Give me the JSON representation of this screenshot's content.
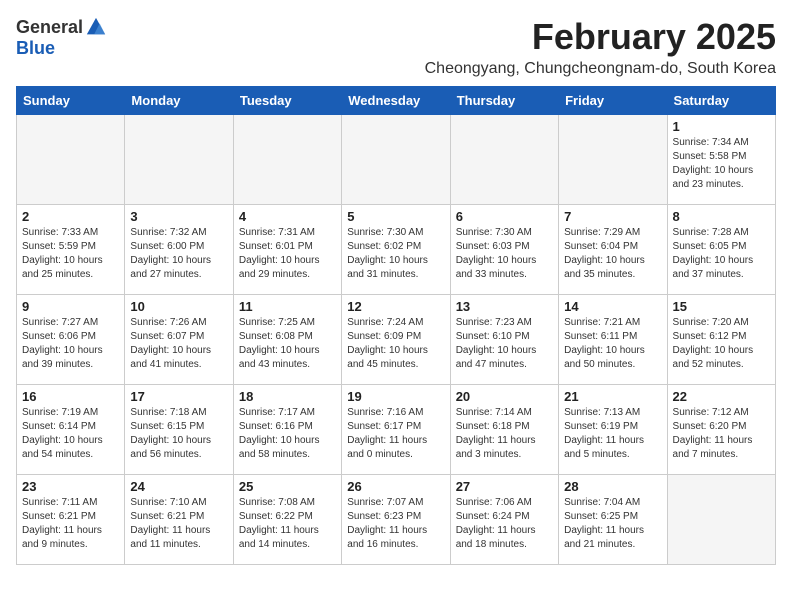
{
  "logo": {
    "general": "General",
    "blue": "Blue"
  },
  "title": "February 2025",
  "location": "Cheongyang, Chungcheongnam-do, South Korea",
  "days_of_week": [
    "Sunday",
    "Monday",
    "Tuesday",
    "Wednesday",
    "Thursday",
    "Friday",
    "Saturday"
  ],
  "weeks": [
    [
      {
        "day": "",
        "info": ""
      },
      {
        "day": "",
        "info": ""
      },
      {
        "day": "",
        "info": ""
      },
      {
        "day": "",
        "info": ""
      },
      {
        "day": "",
        "info": ""
      },
      {
        "day": "",
        "info": ""
      },
      {
        "day": "1",
        "info": "Sunrise: 7:34 AM\nSunset: 5:58 PM\nDaylight: 10 hours\nand 23 minutes."
      }
    ],
    [
      {
        "day": "2",
        "info": "Sunrise: 7:33 AM\nSunset: 5:59 PM\nDaylight: 10 hours\nand 25 minutes."
      },
      {
        "day": "3",
        "info": "Sunrise: 7:32 AM\nSunset: 6:00 PM\nDaylight: 10 hours\nand 27 minutes."
      },
      {
        "day": "4",
        "info": "Sunrise: 7:31 AM\nSunset: 6:01 PM\nDaylight: 10 hours\nand 29 minutes."
      },
      {
        "day": "5",
        "info": "Sunrise: 7:30 AM\nSunset: 6:02 PM\nDaylight: 10 hours\nand 31 minutes."
      },
      {
        "day": "6",
        "info": "Sunrise: 7:30 AM\nSunset: 6:03 PM\nDaylight: 10 hours\nand 33 minutes."
      },
      {
        "day": "7",
        "info": "Sunrise: 7:29 AM\nSunset: 6:04 PM\nDaylight: 10 hours\nand 35 minutes."
      },
      {
        "day": "8",
        "info": "Sunrise: 7:28 AM\nSunset: 6:05 PM\nDaylight: 10 hours\nand 37 minutes."
      }
    ],
    [
      {
        "day": "9",
        "info": "Sunrise: 7:27 AM\nSunset: 6:06 PM\nDaylight: 10 hours\nand 39 minutes."
      },
      {
        "day": "10",
        "info": "Sunrise: 7:26 AM\nSunset: 6:07 PM\nDaylight: 10 hours\nand 41 minutes."
      },
      {
        "day": "11",
        "info": "Sunrise: 7:25 AM\nSunset: 6:08 PM\nDaylight: 10 hours\nand 43 minutes."
      },
      {
        "day": "12",
        "info": "Sunrise: 7:24 AM\nSunset: 6:09 PM\nDaylight: 10 hours\nand 45 minutes."
      },
      {
        "day": "13",
        "info": "Sunrise: 7:23 AM\nSunset: 6:10 PM\nDaylight: 10 hours\nand 47 minutes."
      },
      {
        "day": "14",
        "info": "Sunrise: 7:21 AM\nSunset: 6:11 PM\nDaylight: 10 hours\nand 50 minutes."
      },
      {
        "day": "15",
        "info": "Sunrise: 7:20 AM\nSunset: 6:12 PM\nDaylight: 10 hours\nand 52 minutes."
      }
    ],
    [
      {
        "day": "16",
        "info": "Sunrise: 7:19 AM\nSunset: 6:14 PM\nDaylight: 10 hours\nand 54 minutes."
      },
      {
        "day": "17",
        "info": "Sunrise: 7:18 AM\nSunset: 6:15 PM\nDaylight: 10 hours\nand 56 minutes."
      },
      {
        "day": "18",
        "info": "Sunrise: 7:17 AM\nSunset: 6:16 PM\nDaylight: 10 hours\nand 58 minutes."
      },
      {
        "day": "19",
        "info": "Sunrise: 7:16 AM\nSunset: 6:17 PM\nDaylight: 11 hours\nand 0 minutes."
      },
      {
        "day": "20",
        "info": "Sunrise: 7:14 AM\nSunset: 6:18 PM\nDaylight: 11 hours\nand 3 minutes."
      },
      {
        "day": "21",
        "info": "Sunrise: 7:13 AM\nSunset: 6:19 PM\nDaylight: 11 hours\nand 5 minutes."
      },
      {
        "day": "22",
        "info": "Sunrise: 7:12 AM\nSunset: 6:20 PM\nDaylight: 11 hours\nand 7 minutes."
      }
    ],
    [
      {
        "day": "23",
        "info": "Sunrise: 7:11 AM\nSunset: 6:21 PM\nDaylight: 11 hours\nand 9 minutes."
      },
      {
        "day": "24",
        "info": "Sunrise: 7:10 AM\nSunset: 6:21 PM\nDaylight: 11 hours\nand 11 minutes."
      },
      {
        "day": "25",
        "info": "Sunrise: 7:08 AM\nSunset: 6:22 PM\nDaylight: 11 hours\nand 14 minutes."
      },
      {
        "day": "26",
        "info": "Sunrise: 7:07 AM\nSunset: 6:23 PM\nDaylight: 11 hours\nand 16 minutes."
      },
      {
        "day": "27",
        "info": "Sunrise: 7:06 AM\nSunset: 6:24 PM\nDaylight: 11 hours\nand 18 minutes."
      },
      {
        "day": "28",
        "info": "Sunrise: 7:04 AM\nSunset: 6:25 PM\nDaylight: 11 hours\nand 21 minutes."
      },
      {
        "day": "",
        "info": ""
      }
    ]
  ]
}
